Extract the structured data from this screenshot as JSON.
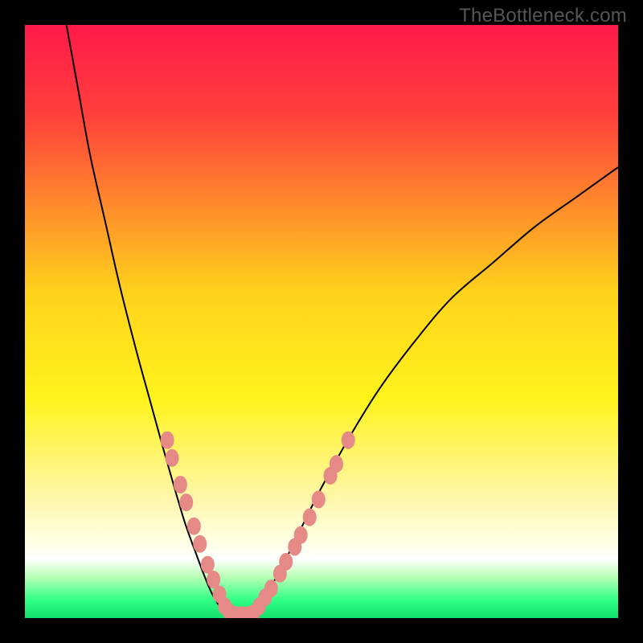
{
  "attribution": "TheBottleneck.com",
  "chart_data": {
    "type": "line",
    "title": "",
    "xlabel": "",
    "ylabel": "",
    "xlim": [
      0,
      100
    ],
    "ylim": [
      0,
      100
    ],
    "gradient_stops": [
      {
        "offset": 0.0,
        "color": "#ff1a4a"
      },
      {
        "offset": 0.15,
        "color": "#ff3f3c"
      },
      {
        "offset": 0.45,
        "color": "#ffd21c"
      },
      {
        "offset": 0.63,
        "color": "#fff31c"
      },
      {
        "offset": 0.8,
        "color": "#fff6ac"
      },
      {
        "offset": 0.86,
        "color": "#ffffdb"
      },
      {
        "offset": 0.9,
        "color": "#ffffff"
      },
      {
        "offset": 0.93,
        "color": "#baffb6"
      },
      {
        "offset": 0.97,
        "color": "#2fff85"
      },
      {
        "offset": 1.0,
        "color": "#14e06e"
      }
    ],
    "series": [
      {
        "name": "left-curve",
        "x": [
          7.0,
          9.0,
          11.0,
          13.5,
          16.0,
          18.8,
          21.0,
          23.2,
          25.2,
          27.0,
          28.8,
          30.3,
          31.6,
          32.8,
          34.0
        ],
        "y": [
          100,
          89,
          78,
          67,
          56,
          45,
          37,
          29,
          22,
          16,
          11,
          7,
          4,
          2,
          0.5
        ]
      },
      {
        "name": "floor",
        "x": [
          34.0,
          35.0,
          36.0,
          37.0,
          38.0
        ],
        "y": [
          0.5,
          0.0,
          0.0,
          0.0,
          0.5
        ]
      },
      {
        "name": "right-curve",
        "x": [
          38.0,
          40.0,
          43.0,
          46.0,
          50.0,
          55.0,
          60.0,
          66.0,
          72.0,
          79.0,
          86.0,
          93.0,
          100.0
        ],
        "y": [
          0.5,
          3,
          8,
          14,
          22,
          31,
          39,
          47,
          54,
          60,
          66,
          71,
          76
        ]
      }
    ],
    "marker_clusters": [
      {
        "name": "left-markers",
        "color": "#e58a87",
        "points": [
          {
            "x": 24.0,
            "y": 30.0
          },
          {
            "x": 24.8,
            "y": 27.0
          },
          {
            "x": 26.2,
            "y": 22.5
          },
          {
            "x": 27.2,
            "y": 19.5
          },
          {
            "x": 28.5,
            "y": 15.5
          },
          {
            "x": 29.5,
            "y": 12.5
          },
          {
            "x": 30.8,
            "y": 9.0
          },
          {
            "x": 31.8,
            "y": 6.5
          },
          {
            "x": 32.8,
            "y": 4.0
          },
          {
            "x": 33.7,
            "y": 2.0
          },
          {
            "x": 34.5,
            "y": 1.0
          },
          {
            "x": 35.5,
            "y": 0.5
          },
          {
            "x": 36.5,
            "y": 0.5
          },
          {
            "x": 37.5,
            "y": 0.5
          }
        ]
      },
      {
        "name": "right-markers",
        "color": "#e58a87",
        "points": [
          {
            "x": 38.5,
            "y": 0.8
          },
          {
            "x": 39.5,
            "y": 2.0
          },
          {
            "x": 40.5,
            "y": 3.5
          },
          {
            "x": 41.5,
            "y": 5.0
          },
          {
            "x": 43.0,
            "y": 7.5
          },
          {
            "x": 44.0,
            "y": 9.5
          },
          {
            "x": 45.5,
            "y": 12.0
          },
          {
            "x": 46.5,
            "y": 14.0
          },
          {
            "x": 48.0,
            "y": 17.0
          },
          {
            "x": 49.5,
            "y": 20.0
          },
          {
            "x": 51.5,
            "y": 24.0
          },
          {
            "x": 52.5,
            "y": 26.0
          },
          {
            "x": 54.5,
            "y": 30.0
          }
        ]
      }
    ]
  }
}
